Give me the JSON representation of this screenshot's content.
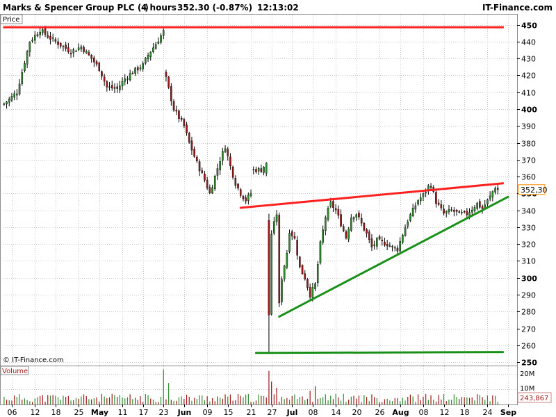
{
  "header": {
    "instrument": "Marks & Spencer Group PLC (-)",
    "timeframe": "4 hours",
    "quote": "352.30 (-0.87%)",
    "time": "12:13:02",
    "brand": "IT-Finance.com"
  },
  "price_panel": {
    "label": "Price",
    "last_price_label": "352,30",
    "copyright": "© IT-Finance.com"
  },
  "volume_panel": {
    "label": "Volume",
    "last_volume_label": "243,867",
    "axis_labels": [
      "20M",
      "10M"
    ]
  },
  "colors": {
    "up": "#2e8b2e",
    "down": "#a01818",
    "resistance": "#ff2020",
    "support": "#189018",
    "accent": "#ff8c00",
    "grid": "#c8c8c8"
  },
  "chart_data": [
    {
      "type": "candlestick",
      "title": "Marks & Spencer Group PLC (-)",
      "ylabel": "Price",
      "ylim": [
        248,
        456
      ],
      "y_ticks": [
        250,
        260,
        270,
        280,
        290,
        300,
        310,
        320,
        330,
        340,
        350,
        360,
        370,
        380,
        390,
        400,
        410,
        420,
        430,
        440,
        450
      ],
      "y_tick_labels": [
        "250",
        "260",
        "270",
        "280",
        "290",
        "300",
        "310",
        "320",
        "330",
        "340",
        "350",
        "360",
        "370",
        "380",
        "390",
        "400",
        "410",
        "420",
        "430",
        "440",
        "450"
      ],
      "y_bold": [
        250,
        300,
        350,
        400,
        450
      ],
      "x_ticks": [
        {
          "label": "06",
          "bar": 3
        },
        {
          "label": "12",
          "bar": 12
        },
        {
          "label": "18",
          "bar": 20
        },
        {
          "label": "25",
          "bar": 29
        },
        {
          "label": "May",
          "bar": 37,
          "bold": true
        },
        {
          "label": "11",
          "bar": 46
        },
        {
          "label": "17",
          "bar": 54
        },
        {
          "label": "23",
          "bar": 62
        },
        {
          "label": "Jun",
          "bar": 70,
          "bold": true
        },
        {
          "label": "09",
          "bar": 79
        },
        {
          "label": "15",
          "bar": 87
        },
        {
          "label": "21",
          "bar": 96
        },
        {
          "label": "27",
          "bar": 104
        },
        {
          "label": "Jul",
          "bar": 112,
          "bold": true
        },
        {
          "label": "08",
          "bar": 120
        },
        {
          "label": "14",
          "bar": 129
        },
        {
          "label": "20",
          "bar": 137
        },
        {
          "label": "26",
          "bar": 146
        },
        {
          "label": "Aug",
          "bar": 154,
          "bold": true
        },
        {
          "label": "08",
          "bar": 163
        },
        {
          "label": "12",
          "bar": 171
        },
        {
          "label": "18",
          "bar": 179
        },
        {
          "label": "24",
          "bar": 188
        },
        {
          "label": "Sep",
          "bar": 196,
          "bold": true
        }
      ],
      "close_series": [
        [
          0,
          403
        ],
        [
          5,
          410
        ],
        [
          8,
          428
        ],
        [
          10,
          440
        ],
        [
          14,
          447
        ],
        [
          18,
          442
        ],
        [
          22,
          438
        ],
        [
          26,
          434
        ],
        [
          30,
          437
        ],
        [
          34,
          430
        ],
        [
          37,
          424
        ],
        [
          40,
          413
        ],
        [
          44,
          412
        ],
        [
          47,
          418
        ],
        [
          50,
          422
        ],
        [
          54,
          426
        ],
        [
          56,
          432
        ],
        [
          60,
          441
        ],
        [
          62,
          446
        ],
        [
          63,
          418
        ],
        [
          66,
          400
        ],
        [
          70,
          390
        ],
        [
          72,
          380
        ],
        [
          75,
          368
        ],
        [
          78,
          358
        ],
        [
          80,
          350
        ],
        [
          82,
          360
        ],
        [
          84,
          370
        ],
        [
          86,
          378
        ],
        [
          88,
          366
        ],
        [
          90,
          356
        ],
        [
          92,
          350
        ],
        [
          94,
          346
        ],
        [
          96,
          350
        ],
        [
          97,
          364
        ],
        [
          100,
          364
        ],
        [
          102,
          368
        ],
        [
          103,
          260
        ],
        [
          104,
          326
        ],
        [
          106,
          338
        ],
        [
          107,
          284
        ],
        [
          108,
          300
        ],
        [
          110,
          315
        ],
        [
          111,
          328
        ],
        [
          113,
          323
        ],
        [
          115,
          306
        ],
        [
          117,
          300
        ],
        [
          119,
          290
        ],
        [
          121,
          296
        ],
        [
          123,
          320
        ],
        [
          125,
          336
        ],
        [
          127,
          344
        ],
        [
          129,
          340
        ],
        [
          131,
          332
        ],
        [
          133,
          324
        ],
        [
          135,
          336
        ],
        [
          137,
          338
        ],
        [
          139,
          332
        ],
        [
          141,
          326
        ],
        [
          143,
          318
        ],
        [
          145,
          322
        ],
        [
          147,
          321
        ],
        [
          149,
          320
        ],
        [
          151,
          318
        ],
        [
          153,
          317
        ],
        [
          155,
          326
        ],
        [
          157,
          334
        ],
        [
          159,
          340
        ],
        [
          161,
          346
        ],
        [
          163,
          349
        ],
        [
          165,
          354
        ],
        [
          166,
          355
        ],
        [
          168,
          345
        ],
        [
          171,
          338
        ],
        [
          174,
          340
        ],
        [
          177,
          338
        ],
        [
          180,
          338
        ],
        [
          184,
          344
        ],
        [
          186,
          341
        ],
        [
          189,
          348
        ],
        [
          191,
          354
        ],
        [
          192,
          352.3
        ]
      ],
      "gaps": [
        [
          62,
          63
        ],
        [
          96,
          97
        ],
        [
          102,
          103
        ]
      ],
      "annotations": [
        {
          "kind": "line",
          "color": "resistance",
          "from": [
            0,
            448.5
          ],
          "to": [
            194,
            448.5
          ]
        },
        {
          "kind": "line",
          "color": "resistance",
          "from": [
            92,
            341.5
          ],
          "to": [
            194,
            356
          ]
        },
        {
          "kind": "line",
          "color": "support",
          "from": [
            107,
            277
          ],
          "to": [
            196,
            348
          ]
        },
        {
          "kind": "line",
          "color": "support",
          "from": [
            98,
            255.5
          ],
          "to": [
            194,
            256
          ]
        }
      ],
      "last_price": 352.3
    },
    {
      "type": "bar",
      "title": "Volume",
      "ylim": [
        0,
        25000000
      ],
      "y_ticks": [
        10000000,
        20000000
      ],
      "last_value": 243867,
      "spikes": [
        [
          62,
          23000000
        ],
        [
          64,
          14000000
        ],
        [
          103,
          22000000
        ],
        [
          104,
          15000000
        ],
        [
          106,
          11000000
        ],
        [
          119,
          9000000
        ],
        [
          121,
          12000000
        ],
        [
          129,
          7000000
        ]
      ]
    }
  ]
}
